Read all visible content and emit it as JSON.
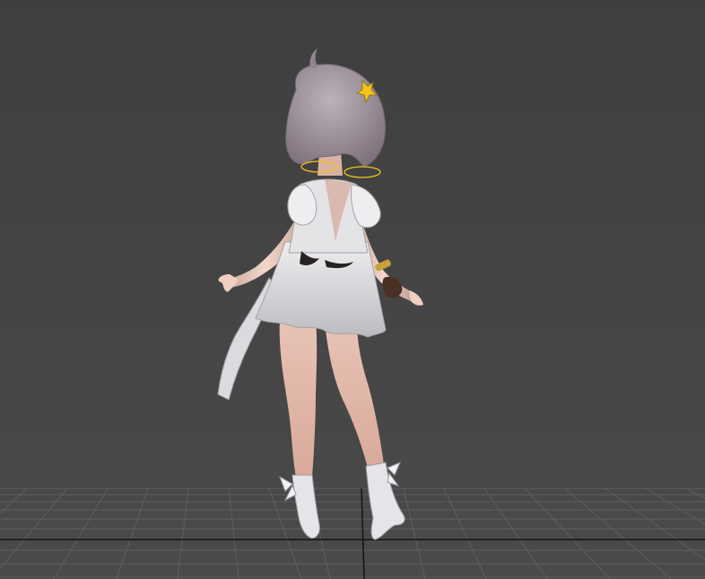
{
  "viewport": {
    "background_color": "#444444",
    "grid_color": "#5f5f5f",
    "axis_color": "#111111",
    "grid_visible": true
  },
  "model": {
    "skin_color": "#e8c9bb",
    "hair_color": "#9c9099",
    "dress_color": "#d6d4d8",
    "accent_color": "#f0c419"
  }
}
